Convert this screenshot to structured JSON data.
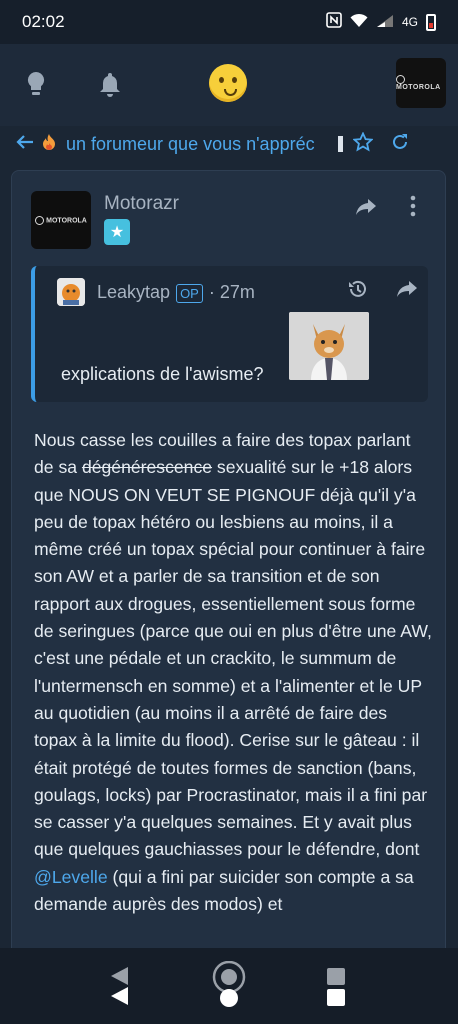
{
  "status_bar": {
    "time": "02:02",
    "network": "4G",
    "icons": [
      "nfc-icon",
      "wifi-icon",
      "signal-icon",
      "battery-low-icon"
    ]
  },
  "app_bar": {
    "icons": [
      "lightbulb-icon",
      "bell-icon",
      "emoji-face-icon",
      "profile-avatar"
    ],
    "avatar_brand": "MOTOROLA"
  },
  "topic": {
    "title": "un forumeur que vous n'appréc",
    "icons": [
      "back-arrow-icon",
      "fire-icon",
      "star-icon",
      "refresh-icon"
    ]
  },
  "post": {
    "author": "Motorazr",
    "author_avatar_brand": "MOTOROLA",
    "quote": {
      "author": "Leakytap",
      "op_label": "OP",
      "time": "· 27m",
      "text": "explications de l'awisme?"
    },
    "body": {
      "before_strike": "Nous casse les couilles a faire des topax parlant de sa ",
      "strike": "dégénérescence",
      "after_strike": " sexualité sur le +18 alors que NOUS ON VEUT SE PIGNOUF déjà qu'il y'a peu de topax hétéro ou lesbiens au moins, il a même créé un topax spécial pour continuer à faire son AW et a parler de sa transition et de son rapport aux drogues, essentiellement sous forme de seringues (parce que oui en plus d'être une AW, c'est une pédale et un crackito, le summum de l'untermensch en somme) et a l'alimenter et le UP au quotidien (au moins il a arrêté de faire des topax à la limite du flood). Cerise sur le gâteau : il était protégé de toutes formes de sanction (bans, goulags, locks) par Procrastinator, mais il a fini par se casser y'a quelques semaines. Et y avait plus que quelques gauchiasses pour le défendre, dont ",
      "mention": "@Levelle",
      "after_mention": " (qui a fini par suicider son compte a sa demande auprès des modos) et"
    }
  },
  "colors": {
    "accent": "#4ea8ec",
    "background": "#1b2634",
    "card": "#223042"
  }
}
